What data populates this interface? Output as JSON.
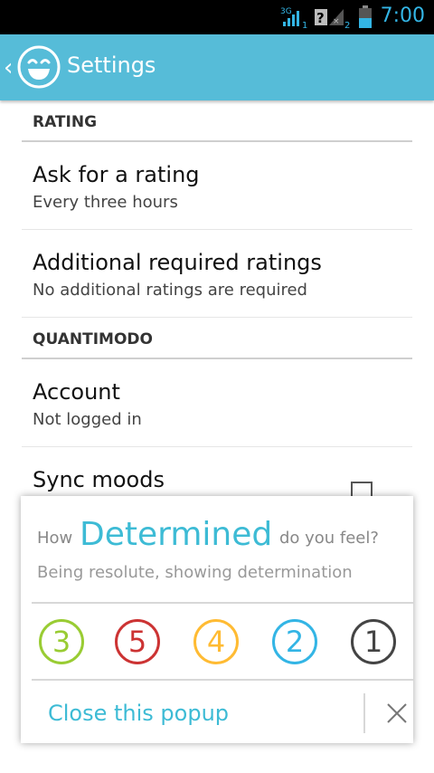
{
  "status_bar": {
    "network_badge": "3G",
    "sim1": "1",
    "sim2": "2",
    "time": "7:00"
  },
  "action_bar": {
    "title": "Settings"
  },
  "settings": {
    "categories": [
      {
        "title": "RATING",
        "items": [
          {
            "title": "Ask for a rating",
            "summary": "Every three hours"
          },
          {
            "title": "Additional required ratings",
            "summary": "No additional ratings are required"
          }
        ]
      },
      {
        "title": "QUANTIMODO",
        "items": [
          {
            "title": "Account",
            "summary": "Not logged in"
          },
          {
            "title": "Sync moods",
            "summary": "",
            "checked": false
          }
        ]
      }
    ]
  },
  "popup": {
    "question_prefix": "How",
    "mood": "Determined",
    "question_suffix": "do you feel?",
    "description": "Being resolute, showing determination",
    "ratings": [
      {
        "label": "3",
        "color": "#99cc33"
      },
      {
        "label": "5",
        "color": "#cc3333"
      },
      {
        "label": "4",
        "color": "#ffbb33"
      },
      {
        "label": "2",
        "color": "#33b5e5"
      },
      {
        "label": "1",
        "color": "#444444"
      }
    ],
    "close_label": "Close this popup"
  },
  "colors": {
    "accent": "#56bcd8",
    "mood_text": "#3dbbd5"
  }
}
